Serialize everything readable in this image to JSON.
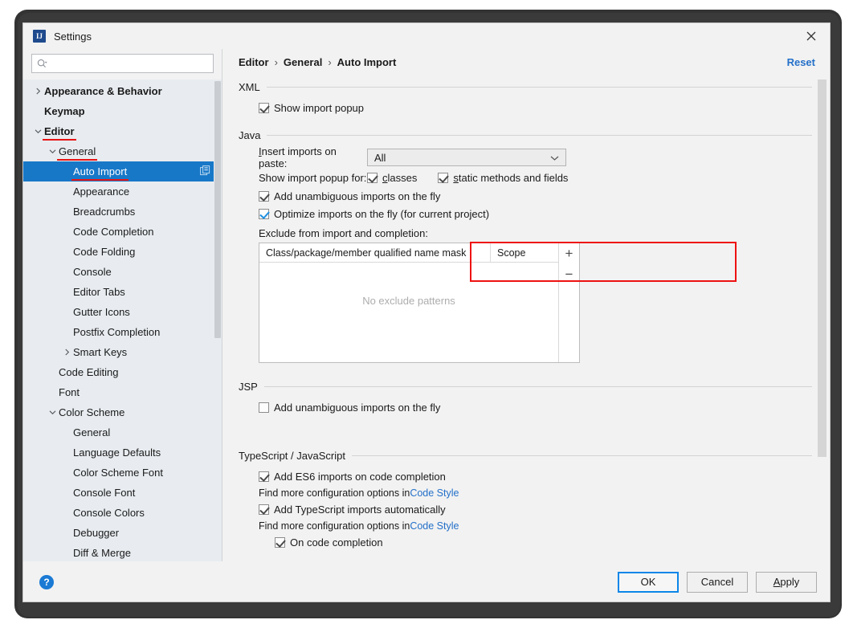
{
  "window": {
    "title": "Settings",
    "app_icon": "intellij-idea-icon",
    "close_icon": "close-icon"
  },
  "sidebar": {
    "search": {
      "placeholder": "",
      "value": "",
      "icon": "search-icon"
    },
    "items": [
      {
        "label": "Appearance & Behavior",
        "depth": 0,
        "arrow": "collapsed",
        "bold": true,
        "selected": false,
        "underline": false
      },
      {
        "label": "Keymap",
        "depth": 0,
        "arrow": "none",
        "bold": true,
        "selected": false,
        "underline": false
      },
      {
        "label": "Editor",
        "depth": 0,
        "arrow": "expanded",
        "bold": true,
        "selected": false,
        "underline": true
      },
      {
        "label": "General",
        "depth": 1,
        "arrow": "expanded",
        "bold": false,
        "selected": false,
        "underline": true
      },
      {
        "label": "Auto Import",
        "depth": 2,
        "arrow": "none",
        "bold": false,
        "selected": true,
        "underline": true
      },
      {
        "label": "Appearance",
        "depth": 2,
        "arrow": "none",
        "bold": false,
        "selected": false,
        "underline": false
      },
      {
        "label": "Breadcrumbs",
        "depth": 2,
        "arrow": "none",
        "bold": false,
        "selected": false,
        "underline": false
      },
      {
        "label": "Code Completion",
        "depth": 2,
        "arrow": "none",
        "bold": false,
        "selected": false,
        "underline": false
      },
      {
        "label": "Code Folding",
        "depth": 2,
        "arrow": "none",
        "bold": false,
        "selected": false,
        "underline": false
      },
      {
        "label": "Console",
        "depth": 2,
        "arrow": "none",
        "bold": false,
        "selected": false,
        "underline": false
      },
      {
        "label": "Editor Tabs",
        "depth": 2,
        "arrow": "none",
        "bold": false,
        "selected": false,
        "underline": false
      },
      {
        "label": "Gutter Icons",
        "depth": 2,
        "arrow": "none",
        "bold": false,
        "selected": false,
        "underline": false
      },
      {
        "label": "Postfix Completion",
        "depth": 2,
        "arrow": "none",
        "bold": false,
        "selected": false,
        "underline": false
      },
      {
        "label": "Smart Keys",
        "depth": 2,
        "arrow": "collapsed",
        "bold": false,
        "selected": false,
        "underline": false
      },
      {
        "label": "Code Editing",
        "depth": 1,
        "arrow": "none",
        "bold": false,
        "selected": false,
        "underline": false
      },
      {
        "label": "Font",
        "depth": 1,
        "arrow": "none",
        "bold": false,
        "selected": false,
        "underline": false
      },
      {
        "label": "Color Scheme",
        "depth": 1,
        "arrow": "expanded",
        "bold": false,
        "selected": false,
        "underline": false
      },
      {
        "label": "General",
        "depth": 2,
        "arrow": "none",
        "bold": false,
        "selected": false,
        "underline": false
      },
      {
        "label": "Language Defaults",
        "depth": 2,
        "arrow": "none",
        "bold": false,
        "selected": false,
        "underline": false
      },
      {
        "label": "Color Scheme Font",
        "depth": 2,
        "arrow": "none",
        "bold": false,
        "selected": false,
        "underline": false
      },
      {
        "label": "Console Font",
        "depth": 2,
        "arrow": "none",
        "bold": false,
        "selected": false,
        "underline": false
      },
      {
        "label": "Console Colors",
        "depth": 2,
        "arrow": "none",
        "bold": false,
        "selected": false,
        "underline": false
      },
      {
        "label": "Debugger",
        "depth": 2,
        "arrow": "none",
        "bold": false,
        "selected": false,
        "underline": false
      },
      {
        "label": "Diff & Merge",
        "depth": 2,
        "arrow": "none",
        "bold": false,
        "selected": false,
        "underline": false
      }
    ]
  },
  "breadcrumb": {
    "parts": [
      "Editor",
      "General",
      "Auto Import"
    ],
    "separator": "›",
    "reset_label": "Reset"
  },
  "sections": {
    "xml": {
      "title": "XML",
      "show_import_popup": {
        "label": "Show import popup",
        "checked": true,
        "accent": "gray"
      }
    },
    "java": {
      "title": "Java",
      "insert_imports_label": "Insert imports on paste:",
      "insert_imports_value": "All",
      "show_import_popup_for_label": "Show import popup for:",
      "classes": {
        "label": "classes",
        "checked": true,
        "accent": "gray"
      },
      "static_methods": {
        "label": "static methods and fields",
        "checked": true,
        "accent": "gray"
      },
      "add_unambiguous": {
        "label": "Add unambiguous imports on the fly",
        "checked": true,
        "accent": "gray"
      },
      "optimize_imports": {
        "label": "Optimize imports on the fly (for current project)",
        "checked": true,
        "accent": "blue"
      },
      "exclude_label": "Exclude from import and completion:",
      "exclude_table": {
        "columns": [
          "Class/package/member qualified name mask",
          "Scope"
        ],
        "rows": [],
        "empty_text": "No exclude patterns",
        "add_button": "+",
        "remove_button": "−"
      }
    },
    "jsp": {
      "title": "JSP",
      "add_unambiguous": {
        "label": "Add unambiguous imports on the fly",
        "checked": false,
        "accent": "gray"
      }
    },
    "typescript": {
      "title": "TypeScript / JavaScript",
      "es6": {
        "label": "Add ES6 imports on code completion",
        "checked": true,
        "accent": "gray"
      },
      "hint1_pre": "Find more configuration options in ",
      "hint1_link": "Code Style",
      "ts_auto": {
        "label": "Add TypeScript imports automatically",
        "checked": true,
        "accent": "gray"
      },
      "hint2_pre": "Find more configuration options in ",
      "hint2_link": "Code Style",
      "on_code_completion": {
        "label": "On code completion",
        "checked": true,
        "accent": "gray"
      }
    }
  },
  "footer": {
    "help_label": "?",
    "ok_label": "OK",
    "cancel_label": "Cancel",
    "apply_label": "Apply"
  },
  "annotations": {
    "highlight_color": "#ee1111",
    "underline_color": "#e81313"
  },
  "colors": {
    "selection_blue": "#1878c8",
    "link_blue": "#2470c9",
    "accent_blue": "#1e8fe0",
    "sidebar_bg": "#e8ecf0",
    "panel_bg": "#f2f2f2"
  }
}
